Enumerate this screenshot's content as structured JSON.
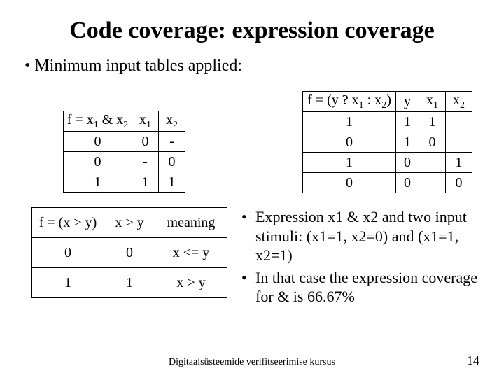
{
  "title": "Code coverage: expression coverage",
  "bullet_main": "Minimum input tables applied:",
  "table1": {
    "h1": "f = x₁ & x₂",
    "h2": "x₁",
    "h3": "x₂",
    "r1c1": "0",
    "r1c2": "0",
    "r1c3": "-",
    "r2c1": "0",
    "r2c2": "-",
    "r2c3": "0",
    "r3c1": "1",
    "r3c2": "1",
    "r3c3": "1"
  },
  "table2": {
    "h1": "f = (y ? x₁ : x₂)",
    "h2": "y",
    "h3": "x₁",
    "h4": "x₂",
    "r1c1": "1",
    "r1c2": "1",
    "r1c3": "1",
    "r1c4": "",
    "r2c1": "0",
    "r2c2": "1",
    "r2c3": "0",
    "r2c4": "",
    "r3c1": "1",
    "r3c2": "0",
    "r3c3": "",
    "r3c4": "1",
    "r4c1": "0",
    "r4c2": "0",
    "r4c3": "",
    "r4c4": "0"
  },
  "table3": {
    "h1": "f = (x > y)",
    "h2": "x > y",
    "h3": "meaning",
    "r1c1": "0",
    "r1c2": "0",
    "r1c3": "x <= y",
    "r2c1": "1",
    "r2c2": "1",
    "r2c3": "x > y"
  },
  "exp": {
    "b1": "Expression x1 & x2 and two input stimuli: (x1=1, x2=0) and (x1=1, x2=1)",
    "b2": "In that case the expression coverage for & is 66.67%"
  },
  "footer": "Digitaalsüsteemide verifitseerimise kursus",
  "page": "14"
}
